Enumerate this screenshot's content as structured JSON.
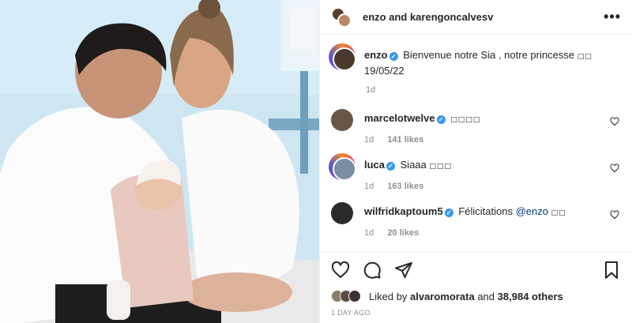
{
  "header": {
    "title": "enzo and karengoncalvesv",
    "more_label": "•••"
  },
  "caption": {
    "user": "enzo",
    "text": "Bienvenue notre Sia , notre princesse",
    "emoji": "□□",
    "date_line": "19/05/22",
    "time": "1d"
  },
  "comments": [
    {
      "user": "marcelotwelve",
      "text": "",
      "emoji": "□□□□",
      "time": "1d",
      "likes": "141 likes"
    },
    {
      "user": "luca",
      "text": "Siaaa",
      "emoji": "□□□",
      "time": "1d",
      "likes": "163 likes"
    },
    {
      "user": "wilfridkaptoum5",
      "text": "Félicitations",
      "mention": "@enzo",
      "emoji": "□□",
      "time": "1d",
      "likes": "20 likes"
    }
  ],
  "liked_by": {
    "prefix": "Liked by",
    "user": "alvaromorata",
    "middle": "and",
    "count": "38,984 others"
  },
  "posted": "1 DAY AGO",
  "icons": {
    "like": "heart-icon",
    "comment": "comment-icon",
    "share": "share-icon",
    "save": "bookmark-icon",
    "more": "more-icon"
  },
  "colors": {
    "verified": "#3897f0",
    "meta": "#8e8e8e",
    "text": "#262626",
    "mention": "#00376b"
  }
}
